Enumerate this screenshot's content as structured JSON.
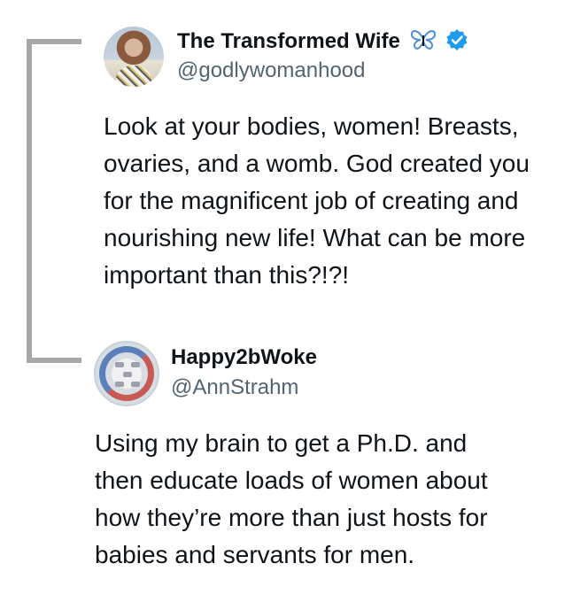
{
  "tweets": [
    {
      "display_name": "The Transformed Wife",
      "handle": "@godlywomanhood",
      "emoji_icon": "butterfly-icon",
      "verified_icon": "verified-badge-icon",
      "text_lines": [
        "Look at your bodies, women! Breasts,",
        "ovaries, and a womb. God created you",
        "for the magnificent job of creating and",
        "nourishing new life! What can be more",
        "important than this?!?!"
      ]
    },
    {
      "display_name": "Happy2bWoke",
      "handle": "@AnnStrahm",
      "text_lines": [
        "Using my brain to get a Ph.D. and",
        "then educate loads of women about",
        "how they’re more than just hosts for",
        "babies and servants for men."
      ]
    }
  ],
  "colors": {
    "name": "#0f1419",
    "handle": "#536471",
    "verified": "#1d9bf0",
    "butterfly": "#4f8fd8",
    "thread_line": "#a7a7a7"
  }
}
